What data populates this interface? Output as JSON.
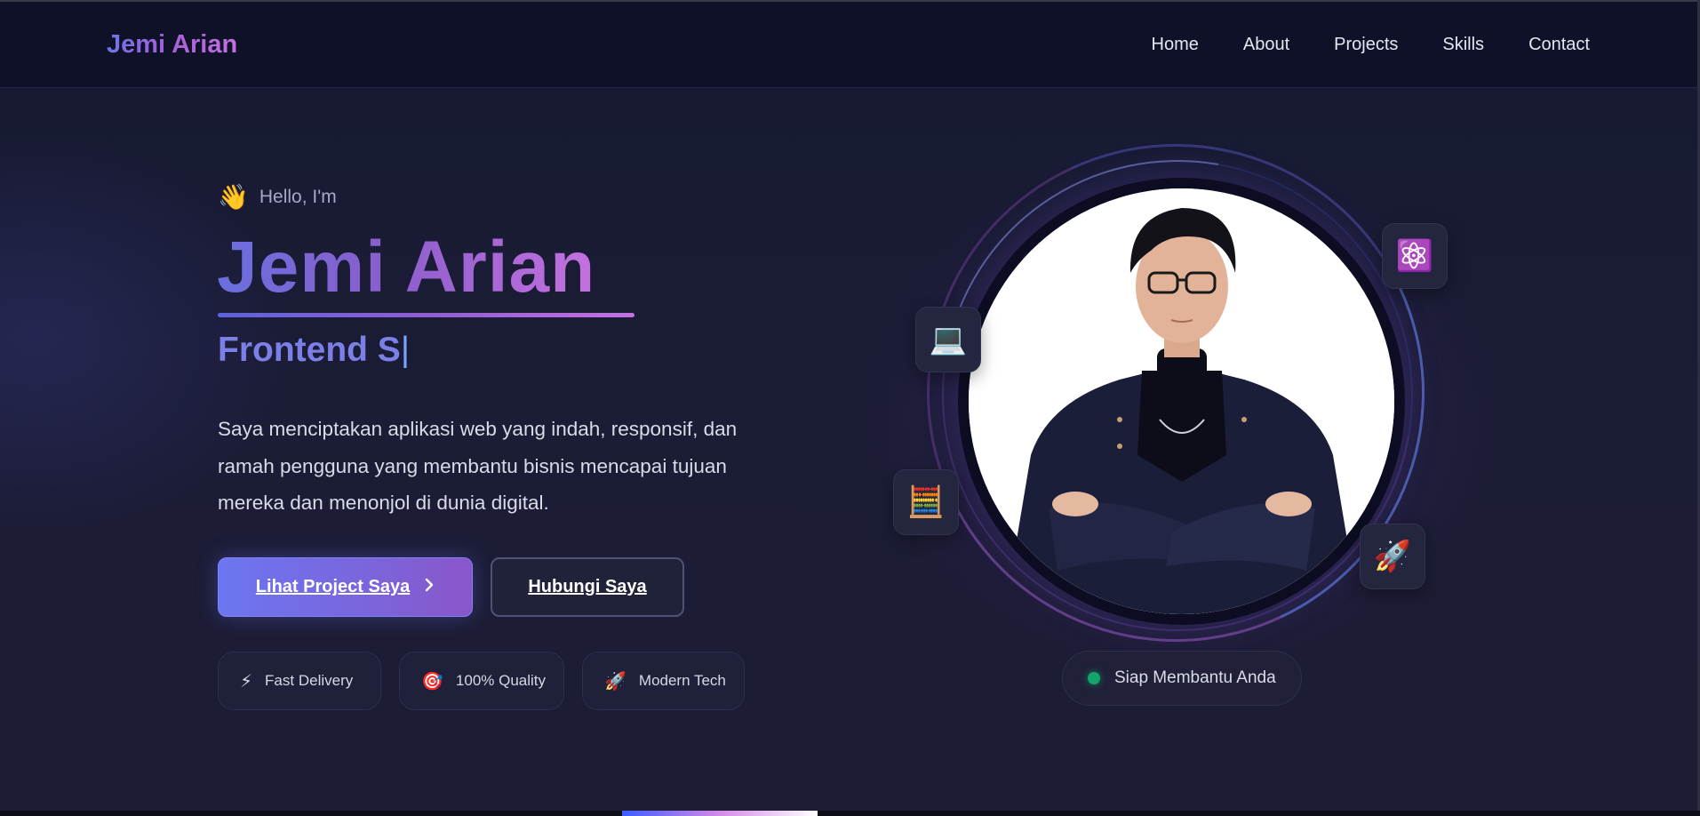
{
  "nav": {
    "brand": "Jemi Arian",
    "links": [
      "Home",
      "About",
      "Projects",
      "Skills",
      "Contact"
    ]
  },
  "hero": {
    "greeting_emoji": "👋",
    "greeting": "Hello, I'm",
    "name": "Jemi Arian",
    "role_typing": "Frontend S",
    "caret": "|",
    "intro": "Saya menciptakan aplikasi web yang indah, responsif, dan ramah pengguna yang membantu bisnis mencapai tujuan mereka dan menonjol di dunia digital.",
    "primary_button": "Lihat Project Saya",
    "secondary_button": "Hubungi Saya",
    "chips": [
      {
        "icon": "⚡",
        "label": "Fast Delivery"
      },
      {
        "icon": "🎯",
        "label": "100% Quality"
      },
      {
        "icon": "🚀",
        "label": "Modern Tech"
      }
    ]
  },
  "profile": {
    "floating_icons": [
      "💻",
      "⚛️",
      "🧮",
      "🚀"
    ],
    "status_text": "Siap Membantu Anda",
    "status_color": "#13a46b"
  },
  "colors": {
    "accent_start": "#6a6fe0",
    "accent_end": "#c571e0",
    "background": "#171a33",
    "navbar": "#0f1129"
  }
}
